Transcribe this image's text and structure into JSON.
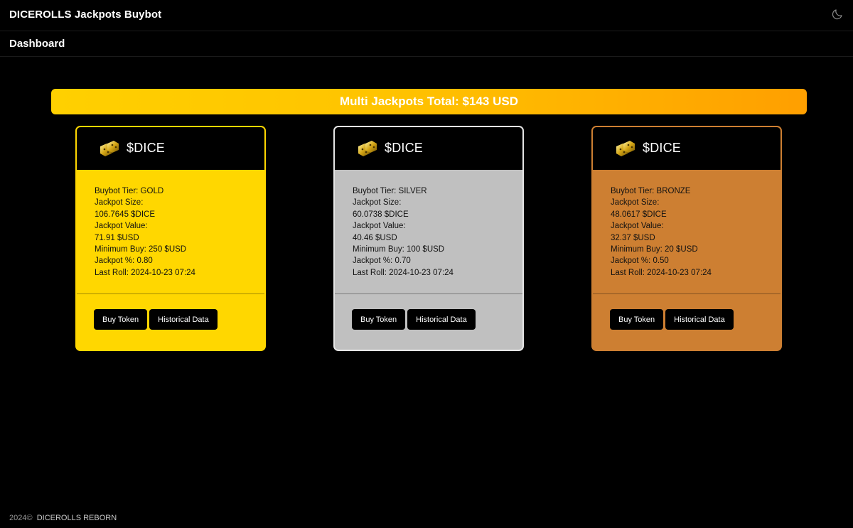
{
  "header": {
    "app_title": "DICEROLLS Jackpots Buybot",
    "theme_toggle_icon": "moon-icon"
  },
  "nav": {
    "dashboard_label": "Dashboard"
  },
  "banner": {
    "text": "Multi Jackpots Total: $143 USD",
    "gradient_start": "#ffd000",
    "gradient_end": "#ff9f00"
  },
  "cards": [
    {
      "token": "$DICE",
      "icon": "dice-icon",
      "color": "#ffd700",
      "border": "#ffd700",
      "tier_line": "Buybot Tier: GOLD",
      "jackpot_size_label": "Jackpot Size:",
      "jackpot_size": "106.7645 $DICE",
      "jackpot_value_label": "Jackpot Value:",
      "jackpot_value": "71.91 $USD",
      "minimum_buy": "Minimum Buy: 250 $USD",
      "jackpot_pct": "Jackpot %: 0.80",
      "last_roll": "Last Roll: 2024-10-23 07:24",
      "buy_label": "Buy Token",
      "history_label": "Historical Data"
    },
    {
      "token": "$DICE",
      "icon": "dice-icon",
      "color": "#c0c0c0",
      "border": "#e6e6e6",
      "tier_line": "Buybot Tier: SILVER",
      "jackpot_size_label": "Jackpot Size:",
      "jackpot_size": "60.0738 $DICE",
      "jackpot_value_label": "Jackpot Value:",
      "jackpot_value": "40.46 $USD",
      "minimum_buy": "Minimum Buy: 100 $USD",
      "jackpot_pct": "Jackpot %: 0.70",
      "last_roll": "Last Roll: 2024-10-23 07:24",
      "buy_label": "Buy Token",
      "history_label": "Historical Data"
    },
    {
      "token": "$DICE",
      "icon": "dice-icon",
      "color": "#cd7f32",
      "border": "#cd7f32",
      "tier_line": "Buybot Tier: BRONZE",
      "jackpot_size_label": "Jackpot Size:",
      "jackpot_size": "48.0617 $DICE",
      "jackpot_value_label": "Jackpot Value:",
      "jackpot_value": "32.37 $USD",
      "minimum_buy": "Minimum Buy: 20 $USD",
      "jackpot_pct": "Jackpot %: 0.50",
      "last_roll": "Last Roll: 2024-10-23 07:24",
      "buy_label": "Buy Token",
      "history_label": "Historical Data"
    }
  ],
  "footer": {
    "year": "2024©",
    "brand": "DICEROLLS REBORN"
  }
}
